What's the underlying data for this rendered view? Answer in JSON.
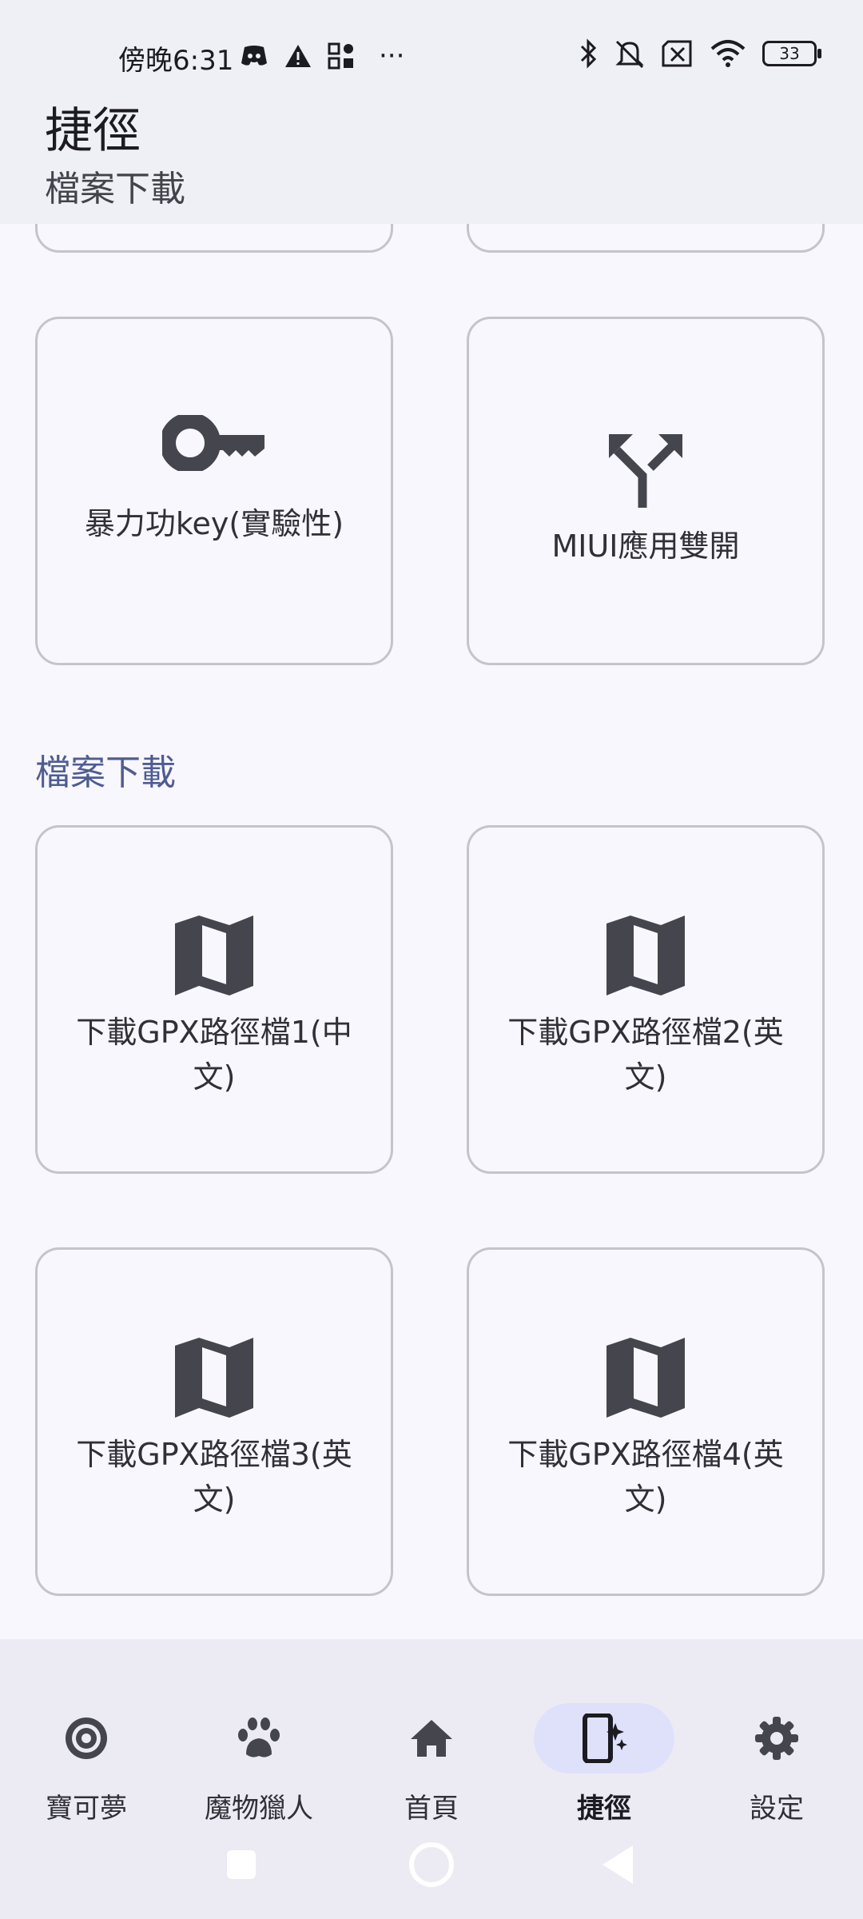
{
  "status": {
    "time": "傍晚6:31",
    "battery": "33",
    "more": "···"
  },
  "header": {
    "title": "捷徑",
    "subtitle": "檔案下載"
  },
  "cards_top": [
    {
      "label": "暴力功key(實驗性)",
      "icon": "key-icon"
    },
    {
      "label": "MIUI應用雙開",
      "icon": "split-arrow-icon"
    }
  ],
  "section": {
    "title": "檔案下載"
  },
  "download_cards": [
    {
      "label": "下載GPX路徑檔1(中文)",
      "icon": "map-icon"
    },
    {
      "label": "下載GPX路徑檔2(英文)",
      "icon": "map-icon"
    },
    {
      "label": "下載GPX路徑檔3(英文)",
      "icon": "map-icon"
    },
    {
      "label": "下載GPX路徑檔4(英文)",
      "icon": "map-icon"
    }
  ],
  "nav": {
    "items": [
      {
        "label": "寶可夢",
        "icon": "pokeball-icon",
        "active": false
      },
      {
        "label": "魔物獵人",
        "icon": "paw-icon",
        "active": false
      },
      {
        "label": "首頁",
        "icon": "home-icon",
        "active": false
      },
      {
        "label": "捷徑",
        "icon": "shortcut-phone-icon",
        "active": true
      },
      {
        "label": "設定",
        "icon": "gear-icon",
        "active": false
      }
    ]
  },
  "colors": {
    "header_bg": "#efeff6",
    "page_bg": "#f8f7fd",
    "accent": "#4f5c92",
    "active_pill": "#dfe1fb"
  }
}
